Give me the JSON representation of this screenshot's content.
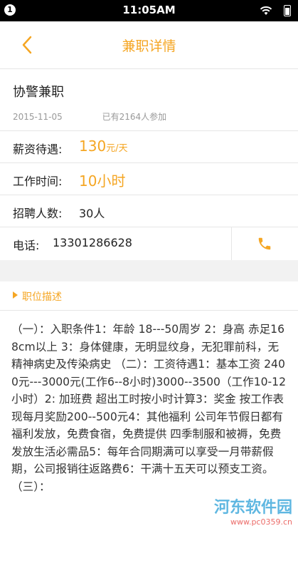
{
  "status_bar": {
    "notification_count": "1",
    "time": "11:05AM"
  },
  "navbar": {
    "title": "兼职详情"
  },
  "job": {
    "title": "协警兼职",
    "date": "2015-11-05",
    "participants": "已有2164人参加"
  },
  "salary": {
    "label": "薪资待遇:",
    "amount": "130",
    "unit": "元/天"
  },
  "work_time": {
    "label": "工作时间:",
    "value": "10小时"
  },
  "recruit": {
    "label": "招聘人数:",
    "value": "30人"
  },
  "phone": {
    "label": "电话:",
    "number": "13301286628"
  },
  "description": {
    "header": "职位描述",
    "body": "（一）：入职条件1：年龄 18---50周岁 2：身高 赤足168cm以上 3：身体健康，无明显纹身，无犯罪前科，无精神病史及传染病史 （二）：工资待遇1：基本工资 2400元---3000元(工作6--8小时)3000--3500（工作10-12小时）2: 加班费 超出工时按小时计算3：奖金 按工作表现每月奖励200--500元4：其他福利 公司年节假日都有福利发放，免费食宿，免费提供 四季制服和被褥，免费发放生活必需品5：每年合同期满可以享受一月带薪假期，公司报销往返路费6：干满十五天可以预支工资。（三）："
  },
  "watermark": {
    "main": "河东软件园",
    "sub": "www.pc0359.cn"
  },
  "colors": {
    "accent": "#f5a623",
    "divider": "#e6e6e6",
    "background": "#f2f2f2"
  }
}
